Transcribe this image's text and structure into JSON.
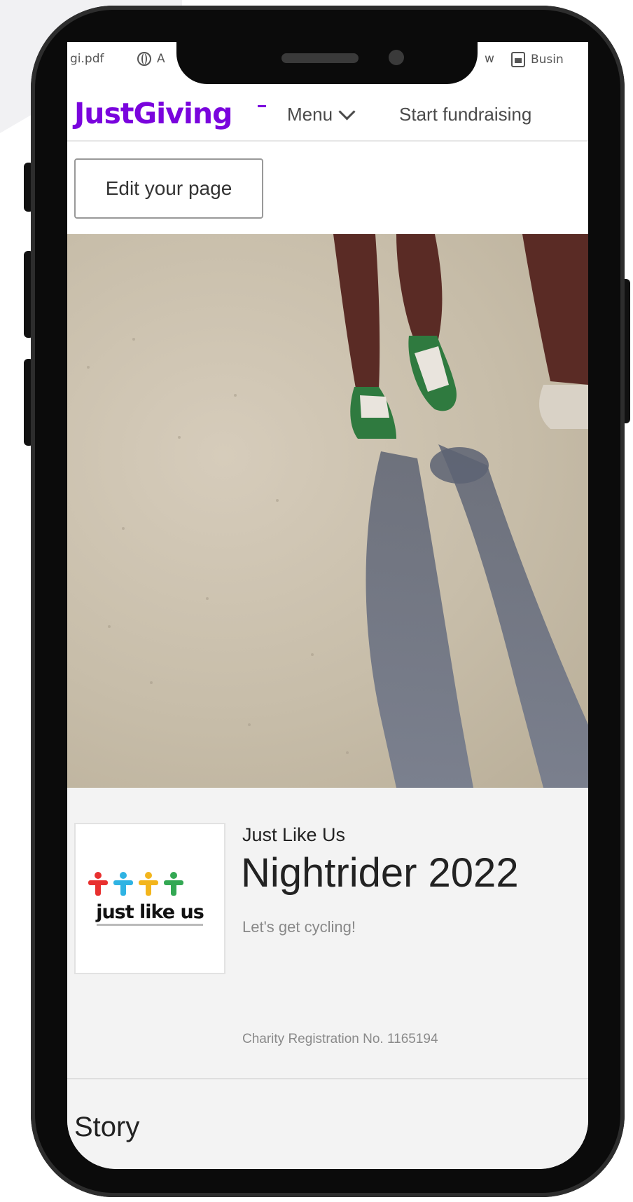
{
  "bookmarks": [
    {
      "label": "gi.pdf",
      "icon": "none"
    },
    {
      "label": "A",
      "icon": "globe-icon"
    },
    {
      "label": "w",
      "icon": "none"
    },
    {
      "label": "Busin",
      "icon": "doc-icon"
    }
  ],
  "header": {
    "logo_text": "JustGiving",
    "logo_color": "#7a04dd",
    "menu_label": "Menu",
    "start_label": "Start fundraising"
  },
  "edit_button": {
    "label": "Edit your page"
  },
  "page": {
    "charity_logo_text": "just like us",
    "charity_name": "Just Like Us",
    "title": "Nightrider 2022",
    "tagline": "Let's get cycling!",
    "registration": "Charity Registration No. 1165194",
    "story_heading": "Story"
  },
  "colors": {
    "figures": [
      "#e8302f",
      "#2fb3e3",
      "#f3b51c",
      "#33a853"
    ]
  }
}
